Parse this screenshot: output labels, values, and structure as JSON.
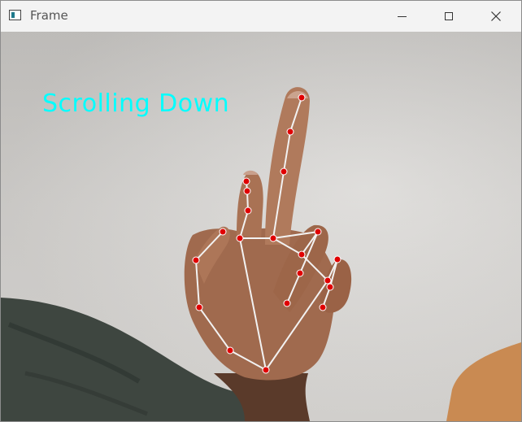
{
  "window": {
    "title": "Frame",
    "controls": {
      "minimize": "minimize",
      "maximize": "maximize",
      "close": "close"
    }
  },
  "overlay": {
    "status_text": "Scrolling Down",
    "text_color": "#00ffff"
  },
  "hand_tracking": {
    "landmark_color": "#e00000",
    "connection_color": "#f2f2f2"
  }
}
